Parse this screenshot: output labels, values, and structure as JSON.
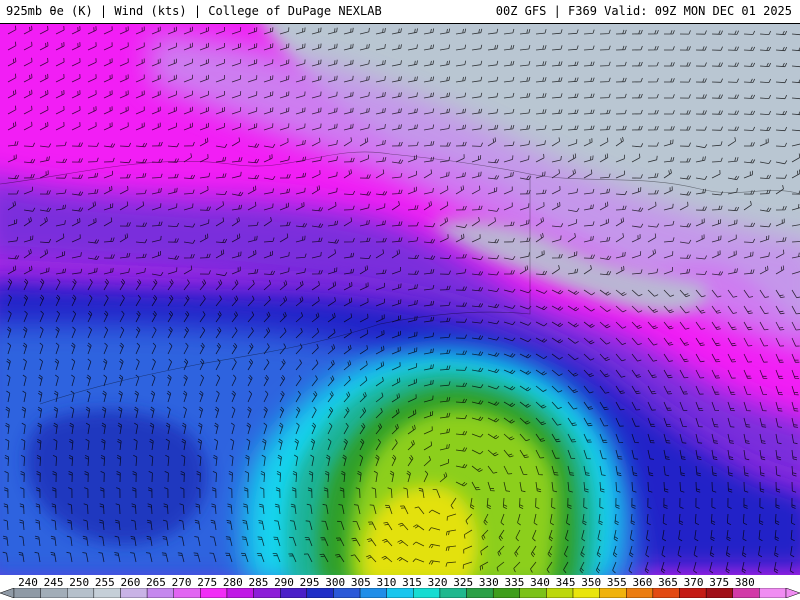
{
  "header": {
    "left_title": "925mb θe (K) | Wind (kts) | College of DuPage NEXLAB",
    "right_title": "00Z GFS | F369 Valid: 09Z MON DEC 01 2025"
  },
  "map": {
    "field": "925mb theta-e",
    "overlay": "wind barbs",
    "colors": {
      "cold_gray": "#b6c3d0",
      "violet": "#c27df0",
      "magenta": "#f21ef5",
      "purple": "#6a2fdc",
      "navy": "#1f1fcc",
      "blue": "#2d62e0",
      "cyan": "#19d6f0",
      "teal": "#1fb39a",
      "green": "#2fa02c",
      "lime": "#8ccf1a",
      "yellow": "#e6e40c"
    }
  },
  "legend": {
    "labels": [
      "240",
      "245",
      "250",
      "255",
      "260",
      "265",
      "270",
      "275",
      "280",
      "285",
      "290",
      "295",
      "300",
      "305",
      "310",
      "315",
      "320",
      "325",
      "330",
      "335",
      "340",
      "345",
      "350",
      "355",
      "360",
      "365",
      "370",
      "375",
      "380"
    ],
    "colors": [
      "#8f9aa6",
      "#a2adb8",
      "#b5c0cb",
      "#c5cfd8",
      "#c9b3e6",
      "#c588ee",
      "#e165f2",
      "#f12ef6",
      "#c018e6",
      "#8c1ed8",
      "#4a1fc8",
      "#1f2fc7",
      "#2a59d8",
      "#1f8ee8",
      "#18c6ee",
      "#16dcd2",
      "#1fb88e",
      "#2aa047",
      "#3e9e1c",
      "#7cc218",
      "#bcd80c",
      "#e9e50c",
      "#f0b30c",
      "#ec7d10",
      "#e24a12",
      "#c41c16",
      "#a0101a",
      "#d23aa8",
      "#f08cf2"
    ]
  }
}
